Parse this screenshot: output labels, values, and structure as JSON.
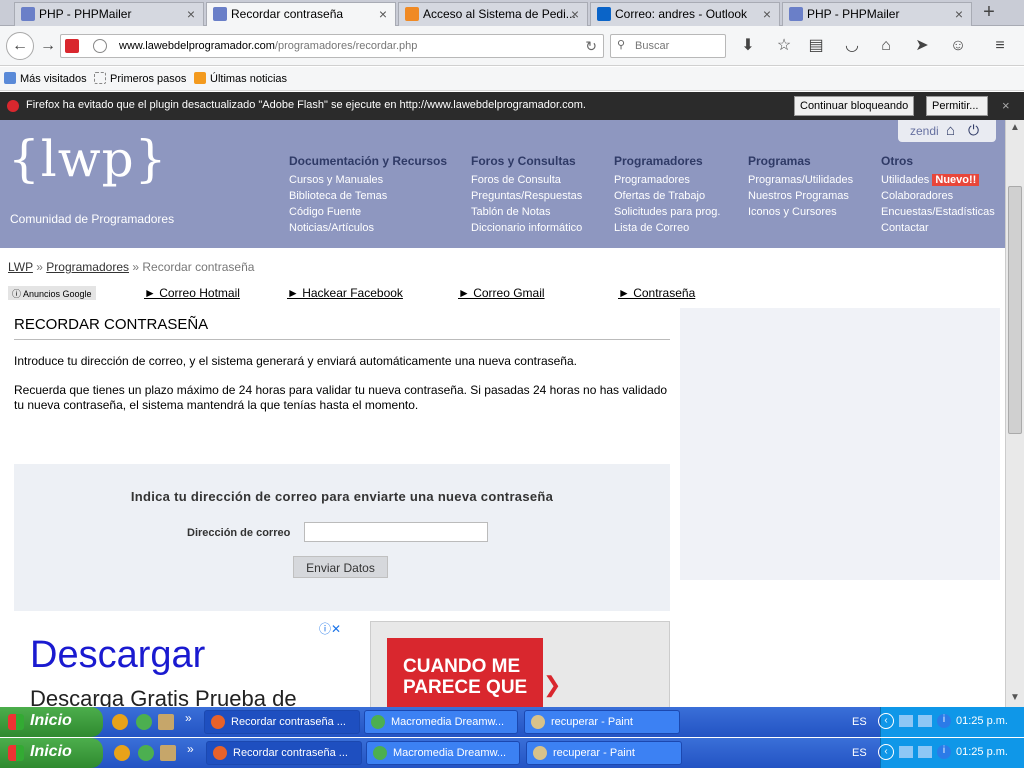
{
  "browser": {
    "tabs": [
      {
        "title": "PHP - PHPMailer",
        "active": false
      },
      {
        "title": "Recordar contraseña",
        "active": true
      },
      {
        "title": "Acceso al Sistema de Pedi...",
        "active": false
      },
      {
        "title": "Correo: andres - Outlook",
        "active": false
      },
      {
        "title": "PHP - PHPMailer",
        "active": false
      }
    ],
    "new_tab_label": "+",
    "url_host": "www.lawebdelprogramador.com",
    "url_path": "/programadores/recordar.php",
    "search_placeholder": "Buscar",
    "bookmarks": [
      "Más visitados",
      "Primeros pasos",
      "Últimas noticias"
    ],
    "notification": {
      "message": "Firefox ha evitado que el plugin desactualizado \"Adobe Flash\" se ejecute en http://www.lawebdelprogramador.com.",
      "keep_blocking": "Continuar bloqueando",
      "allow": "Permitir..."
    }
  },
  "site": {
    "logo": "{lwp}",
    "tagline": "Comunidad de Programadores",
    "username": "zendi",
    "menu": [
      {
        "heading": "Documentación y Recursos",
        "items": [
          "Cursos y Manuales",
          "Biblioteca de Temas",
          "Código Fuente",
          "Noticias/Artículos"
        ]
      },
      {
        "heading": "Foros y Consultas",
        "items": [
          "Foros de Consulta",
          "Preguntas/Respuestas",
          "Tablón de Notas",
          "Diccionario informático"
        ]
      },
      {
        "heading": "Programadores",
        "items": [
          "Programadores",
          "Ofertas de Trabajo",
          "Solicitudes para prog.",
          "Lista de Correo"
        ]
      },
      {
        "heading": "Programas",
        "items": [
          "Programas/Utilidades",
          "Nuestros Programas",
          "Iconos y Cursores"
        ]
      },
      {
        "heading": "Otros",
        "items": [
          "Utilidades",
          "Colaboradores",
          "Encuestas/Estadísticas",
          "Contactar"
        ],
        "badge": "Nuevo!!"
      }
    ],
    "breadcrumb": {
      "home": "LWP",
      "section": "Programadores",
      "current": "Recordar contraseña",
      "sep": "»"
    },
    "ads_badge": "Anuncios Google",
    "ad_links": [
      "► Correo Hotmail",
      "► Hackear Facebook",
      "► Correo Gmail",
      "► Contraseña"
    ],
    "page_title": "RECORDAR CONTRASEÑA",
    "intro": "Introduce tu dirección de correo, y el sistema generará y enviará automáticamente una nueva contraseña.",
    "note": "Recuerda que tienes un plazo máximo de 24 horas para validar tu nueva contraseña. Si pasadas 24 horas no has validado tu nueva contraseña, el sistema mantendrá la que tenías hasta el momento.",
    "form": {
      "title": "Indica tu dirección de correo para enviarte una nueva contraseña",
      "email_label": "Dirección de correo",
      "email_value": "",
      "submit_label": "Enviar Datos"
    },
    "google_ad": {
      "title": "Descargar",
      "text": "Descarga Gratis Prueba de"
    },
    "banner_ad": {
      "text": "CUANDO ME PARECE QUE"
    }
  },
  "taskbars": [
    {
      "start_label": "Inicio",
      "buttons": [
        "Recordar contraseña ...",
        "Macromedia Dreamw...",
        "recuperar - Paint"
      ],
      "lang": "ES",
      "clock": "01:25 p.m."
    },
    {
      "start_label": "Inicio",
      "buttons": [
        "Recordar contraseña ...",
        "Macromedia Dreamw...",
        "recuperar - Paint"
      ],
      "lang": "ES",
      "clock": "01:25 p.m."
    }
  ],
  "colors": {
    "header_bg": "#8e97c0",
    "menu_heading": "#2f3a66",
    "badge_red": "#e8463a",
    "taskbar_blue": "#2353c3",
    "start_green": "#3a9a3a"
  }
}
